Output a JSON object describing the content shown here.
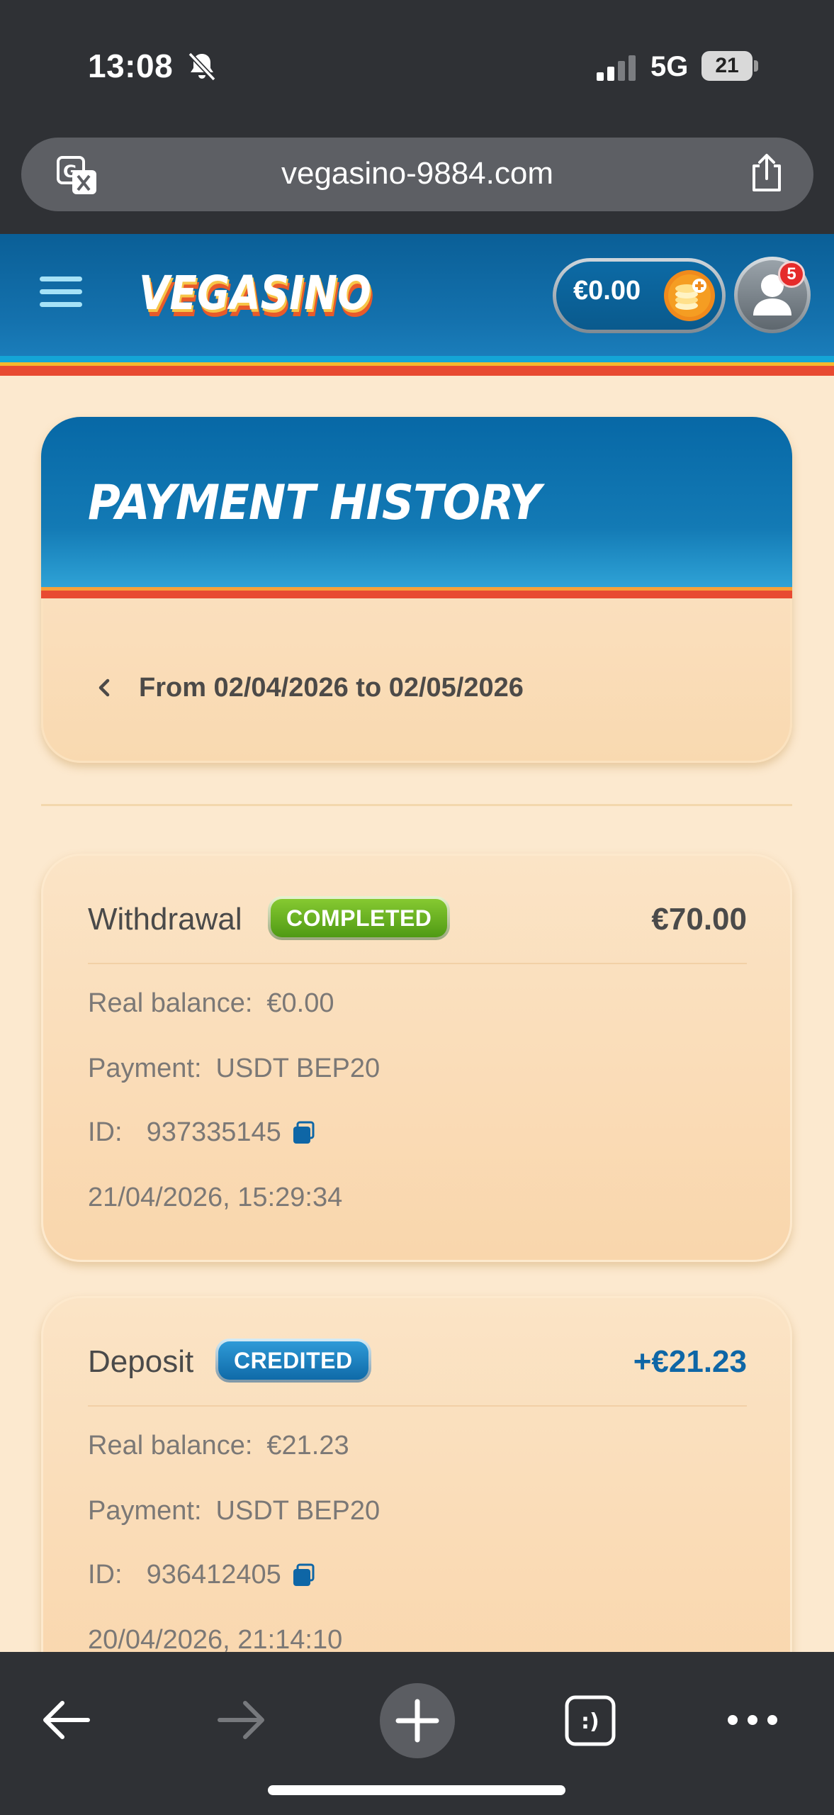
{
  "status_bar": {
    "time": "13:08",
    "network": "5G",
    "battery": "21"
  },
  "browser": {
    "url": "vegasino-9884.com"
  },
  "header": {
    "logo_text": "VEGASINO",
    "balance": "€0.00",
    "notification_count": "5"
  },
  "page": {
    "title": "PAYMENT HISTORY",
    "date_range": "From 02/04/2026 to 02/05/2026"
  },
  "transactions": [
    {
      "type": "Withdrawal",
      "status": "COMPLETED",
      "amount": "€70.00",
      "amount_color": "#4a4a4a",
      "real_balance_label": "Real balance:",
      "real_balance": "€0.00",
      "payment_label": "Payment:",
      "payment": "USDT BEP20",
      "id_label": "ID:",
      "id": "937335145",
      "datetime": "21/04/2026, 15:29:34"
    },
    {
      "type": "Deposit",
      "status": "CREDITED",
      "amount": "+€21.23",
      "amount_color": "#0e66a6",
      "real_balance_label": "Real balance:",
      "real_balance": "€21.23",
      "payment_label": "Payment:",
      "payment": "USDT BEP20",
      "id_label": "ID:",
      "id": "936412405",
      "datetime": "20/04/2026, 21:14:10"
    }
  ],
  "colors": {
    "page_bg": "#fce9cf",
    "header_blue": "#0a5f97",
    "accent_red": "#e84a31",
    "completed_green": "#5aa81b",
    "credited_blue": "#1a7fc0"
  },
  "icons": [
    "silent-bell-icon",
    "signal-icon",
    "battery-icon",
    "translate-icon",
    "share-icon",
    "menu-icon",
    "coins-icon",
    "user-icon",
    "chevron-left-icon",
    "copy-icon",
    "back-arrow-icon",
    "forward-arrow-icon",
    "plus-icon",
    "tabs-icon",
    "more-icon"
  ]
}
